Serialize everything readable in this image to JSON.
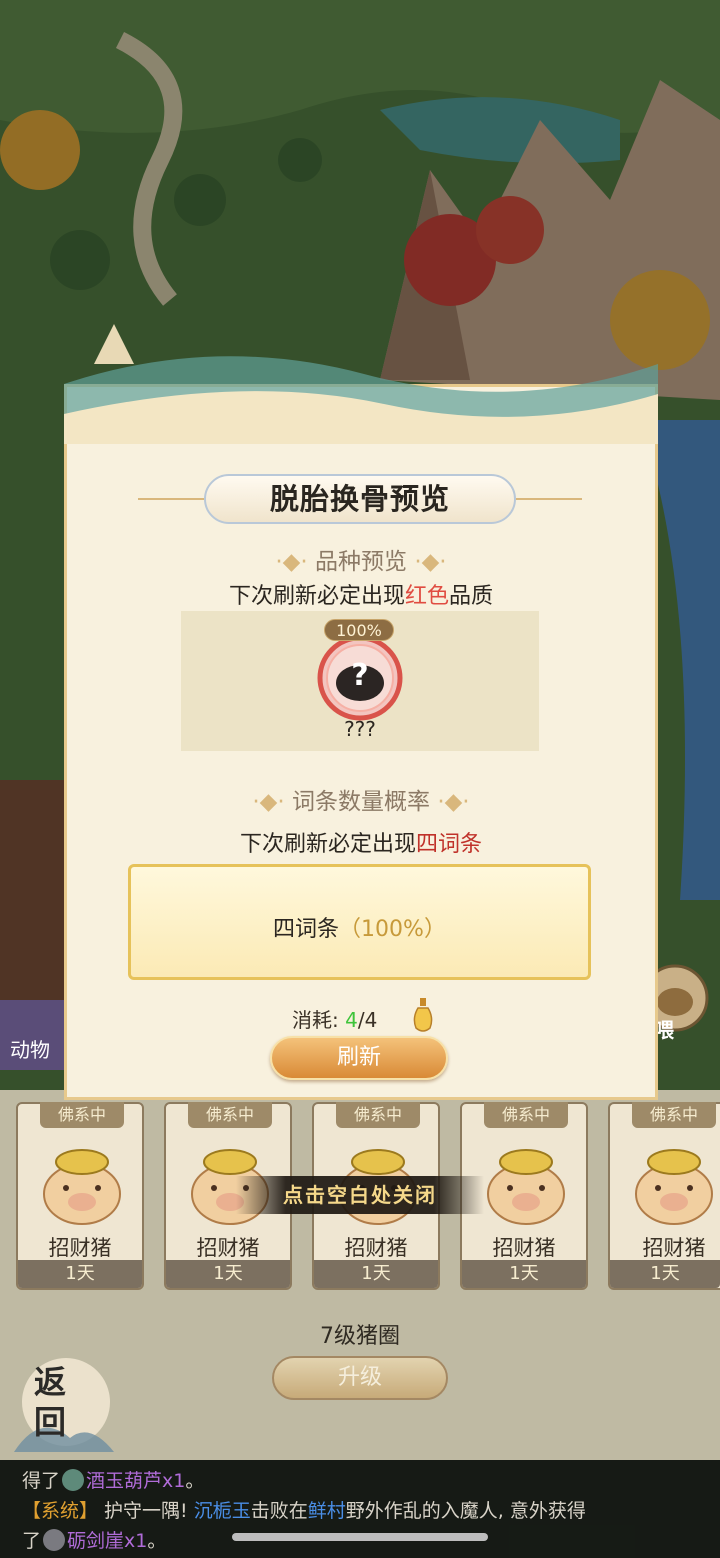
{
  "dialog": {
    "title": "脱胎换骨预览",
    "breed_section_title": "品种预览",
    "breed_text_prefix": "下次刷新必定出现",
    "breed_text_highlight": "红色",
    "breed_text_suffix": "品质",
    "preview_item": {
      "chance": "100%",
      "name": "???",
      "icon": "question-pig-icon"
    },
    "entry_section_title": "词条数量概率",
    "entry_text_prefix": "下次刷新必定出现",
    "entry_text_highlight": "四词条",
    "result_label": "四词条",
    "result_percent": "（100%）",
    "cost_label": "消耗:",
    "cost_have": "4",
    "cost_sep": "/4",
    "refresh_label": "刷新"
  },
  "close_hint": "点击空白处关闭",
  "side": {
    "animal_label": "动物",
    "feed_label": "喂"
  },
  "pen": {
    "pigs": [
      {
        "status": "佛系中",
        "name": "招财猪",
        "days": "1天"
      },
      {
        "status": "佛系中",
        "name": "招财猪",
        "days": "1天"
      },
      {
        "status": "佛系中",
        "name": "招财猪",
        "days": "1天"
      },
      {
        "status": "佛系中",
        "name": "招财猪",
        "days": "1天"
      },
      {
        "status": "佛系中",
        "name": "招财猪",
        "days": "1天"
      }
    ],
    "level": "7级猪圈",
    "upgrade_label": "升级",
    "back_label_1": "返",
    "back_label_2": "回"
  },
  "chat": {
    "line1_prefix": "得了",
    "line1_item": "酒玉葫芦x1",
    "line1_suffix": "。",
    "line2_tag": "【系统】",
    "line2_a": " 护守一隅! ",
    "line2_player": "沉栀玉",
    "line2_b": "击败在",
    "line2_place": "鲜村",
    "line2_c": "野外作乱的入魔人, 意外获得",
    "line3_prefix": "了",
    "line3_item": "砺剑崖x1",
    "line3_suffix": "。"
  },
  "colors": {
    "highlight_red": "#e04c41",
    "gold": "#e6c25a",
    "cost_green": "#3ec43a"
  }
}
